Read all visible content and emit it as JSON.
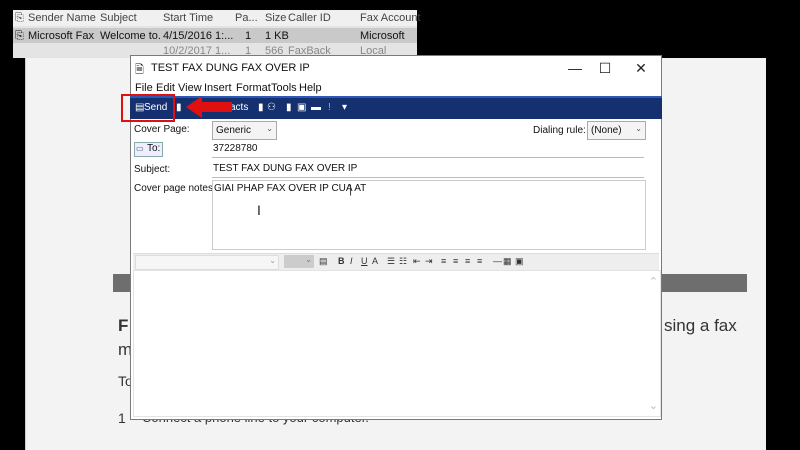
{
  "fax_list": {
    "columns": [
      "Sender Name",
      "Subject",
      "Start Time",
      "Pa...",
      "Size",
      "Caller ID",
      "Fax Account"
    ],
    "rows": [
      [
        "Microsoft Fax ...",
        "Welcome to...",
        "4/15/2016 1:...",
        "1",
        "1 KB",
        "",
        "Microsoft"
      ],
      [
        "",
        "",
        "10/2/2017 1...",
        "1",
        "566",
        "FaxBack",
        "Local"
      ]
    ]
  },
  "background_doc": {
    "heading_left": "F",
    "heading_right": "sing a fax",
    "line2_left": "m",
    "line3_left": "To",
    "step_number": "1",
    "step_text": "Connect a phone line to your computer."
  },
  "window": {
    "title": "TEST FAX DUNG FAX OVER IP",
    "controls": {
      "minimize": "—",
      "maximize": "☐",
      "close": "✕"
    }
  },
  "menu": [
    "File",
    "Edit",
    "View",
    "Insert",
    "Format",
    "Tools",
    "Help"
  ],
  "toolbar": {
    "send_label": "Send",
    "contacts_label": "acts"
  },
  "form": {
    "cover_page_label": "Cover Page:",
    "cover_page_value": "Generic",
    "dialing_rule_label": "Dialing rule:",
    "dialing_rule_value": "(None)",
    "to_label": "To:",
    "to_value": "37228780",
    "subject_label": "Subject:",
    "subject_value": "TEST FAX DUNG FAX OVER IP",
    "cover_notes_label": "Cover page notes:",
    "cover_notes_value": "GIAI PHAP FAX OVER IP CUA AT"
  },
  "colors": {
    "toolbar_bg": "#15306e",
    "highlight": "#e01010"
  }
}
